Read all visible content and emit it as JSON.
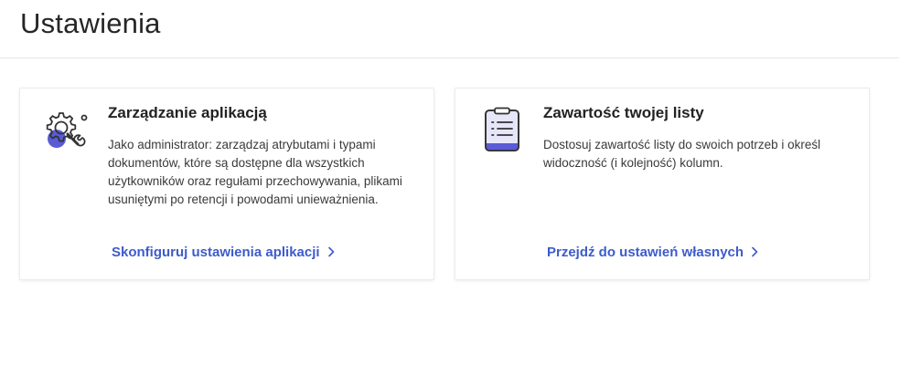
{
  "page": {
    "title": "Ustawienia"
  },
  "cards": [
    {
      "icon": "gear-wrench-icon",
      "title": "Zarządzanie aplikacją",
      "description": "Jako administrator: zarządzaj atrybutami i typami dokumentów, które są dostępne dla wszystkich użytkowników oraz regułami przechowywania, plikami usuniętymi po retencji i powodami unieważnienia.",
      "link": "Skonfiguruj ustawienia aplikacji"
    },
    {
      "icon": "clipboard-list-icon",
      "title": "Zawartość twojej listy",
      "description": "Dostosuj zawartość listy do swoich potrzeb i określ widoczność (i kolejność) kolumn.",
      "link": "Przejdź do ustawień własnych"
    }
  ],
  "colors": {
    "accent": "#3d5bcc",
    "icon_purple": "#5b5bd6",
    "icon_lavender": "#e6e6fa",
    "icon_stroke": "#333333"
  }
}
